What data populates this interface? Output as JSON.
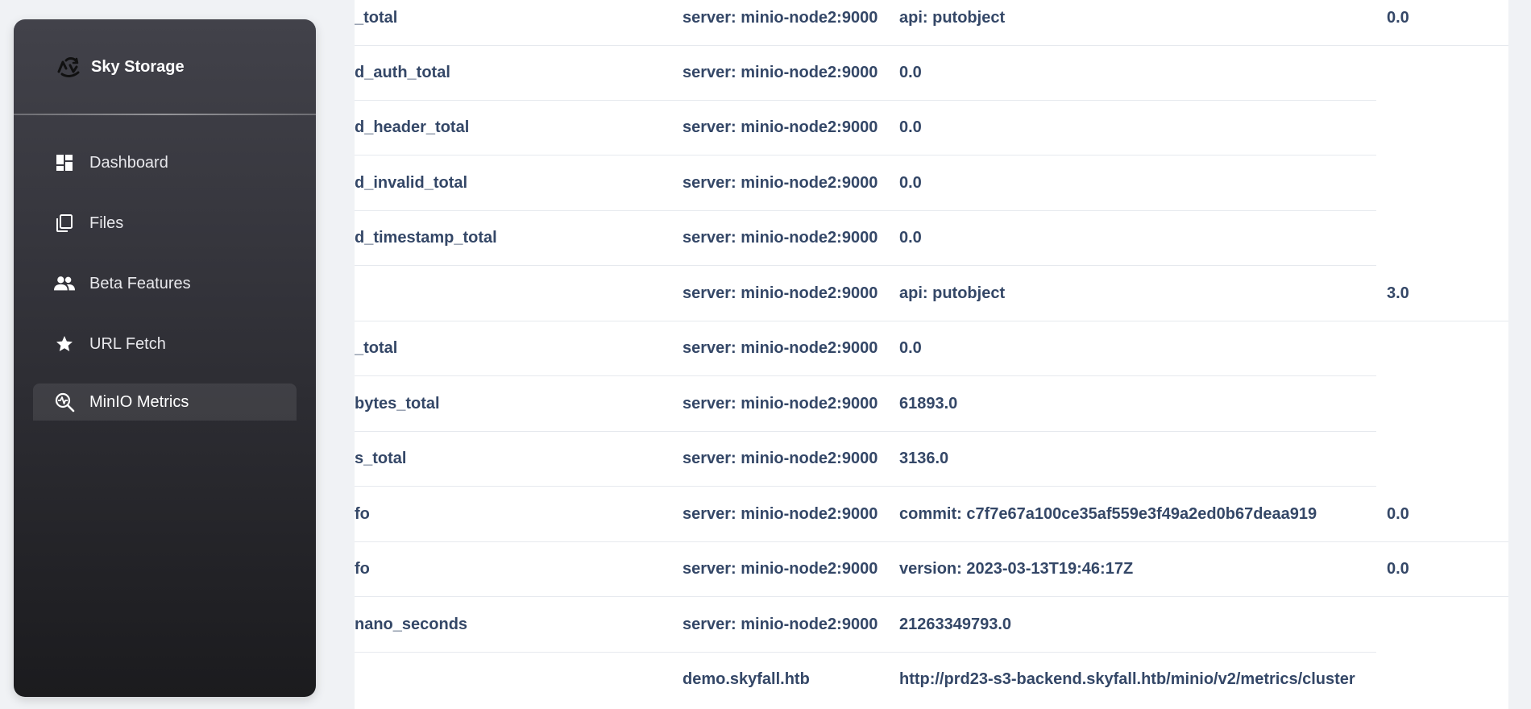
{
  "sidebar": {
    "brand": {
      "title": "Sky Storage",
      "icon": "sky-storage-logo-icon"
    },
    "items": [
      {
        "label": "Dashboard",
        "icon": "dashboard-icon",
        "active": false
      },
      {
        "label": "Files",
        "icon": "files-icon",
        "active": false
      },
      {
        "label": "Beta Features",
        "icon": "people-icon",
        "active": false
      },
      {
        "label": "URL Fetch",
        "icon": "star-icon",
        "active": false
      },
      {
        "label": "MinIO Metrics",
        "icon": "metrics-icon",
        "active": true
      }
    ]
  },
  "metrics_table": {
    "rows": [
      {
        "name": "_total",
        "server": "server: minio-node2:9000",
        "label": "api: putobject",
        "value": "0.0"
      },
      {
        "name": "d_auth_total",
        "server": "server: minio-node2:9000",
        "label": "0.0",
        "value": ""
      },
      {
        "name": "d_header_total",
        "server": "server: minio-node2:9000",
        "label": "0.0",
        "value": ""
      },
      {
        "name": "d_invalid_total",
        "server": "server: minio-node2:9000",
        "label": "0.0",
        "value": ""
      },
      {
        "name": "d_timestamp_total",
        "server": "server: minio-node2:9000",
        "label": "0.0",
        "value": ""
      },
      {
        "name": "",
        "server": "server: minio-node2:9000",
        "label": "api: putobject",
        "value": "3.0"
      },
      {
        "name": "_total",
        "server": "server: minio-node2:9000",
        "label": "0.0",
        "value": ""
      },
      {
        "name": "bytes_total",
        "server": "server: minio-node2:9000",
        "label": "61893.0",
        "value": ""
      },
      {
        "name": "s_total",
        "server": "server: minio-node2:9000",
        "label": "3136.0",
        "value": ""
      },
      {
        "name": "fo",
        "server": "server: minio-node2:9000",
        "label": "commit: c7f7e67a100ce35af559e3f49a2ed0b67deaa919",
        "value": "0.0"
      },
      {
        "name": "fo",
        "server": "server: minio-node2:9000",
        "label": "version: 2023-03-13T19:46:17Z",
        "value": "0.0"
      },
      {
        "name": "nano_seconds",
        "server": "server: minio-node2:9000",
        "label": "21263349793.0",
        "value": ""
      },
      {
        "name": "",
        "server": "demo.skyfall.htb",
        "label": "http://prd23-s3-backend.skyfall.htb/minio/v2/metrics/cluster",
        "value": ""
      }
    ]
  }
}
